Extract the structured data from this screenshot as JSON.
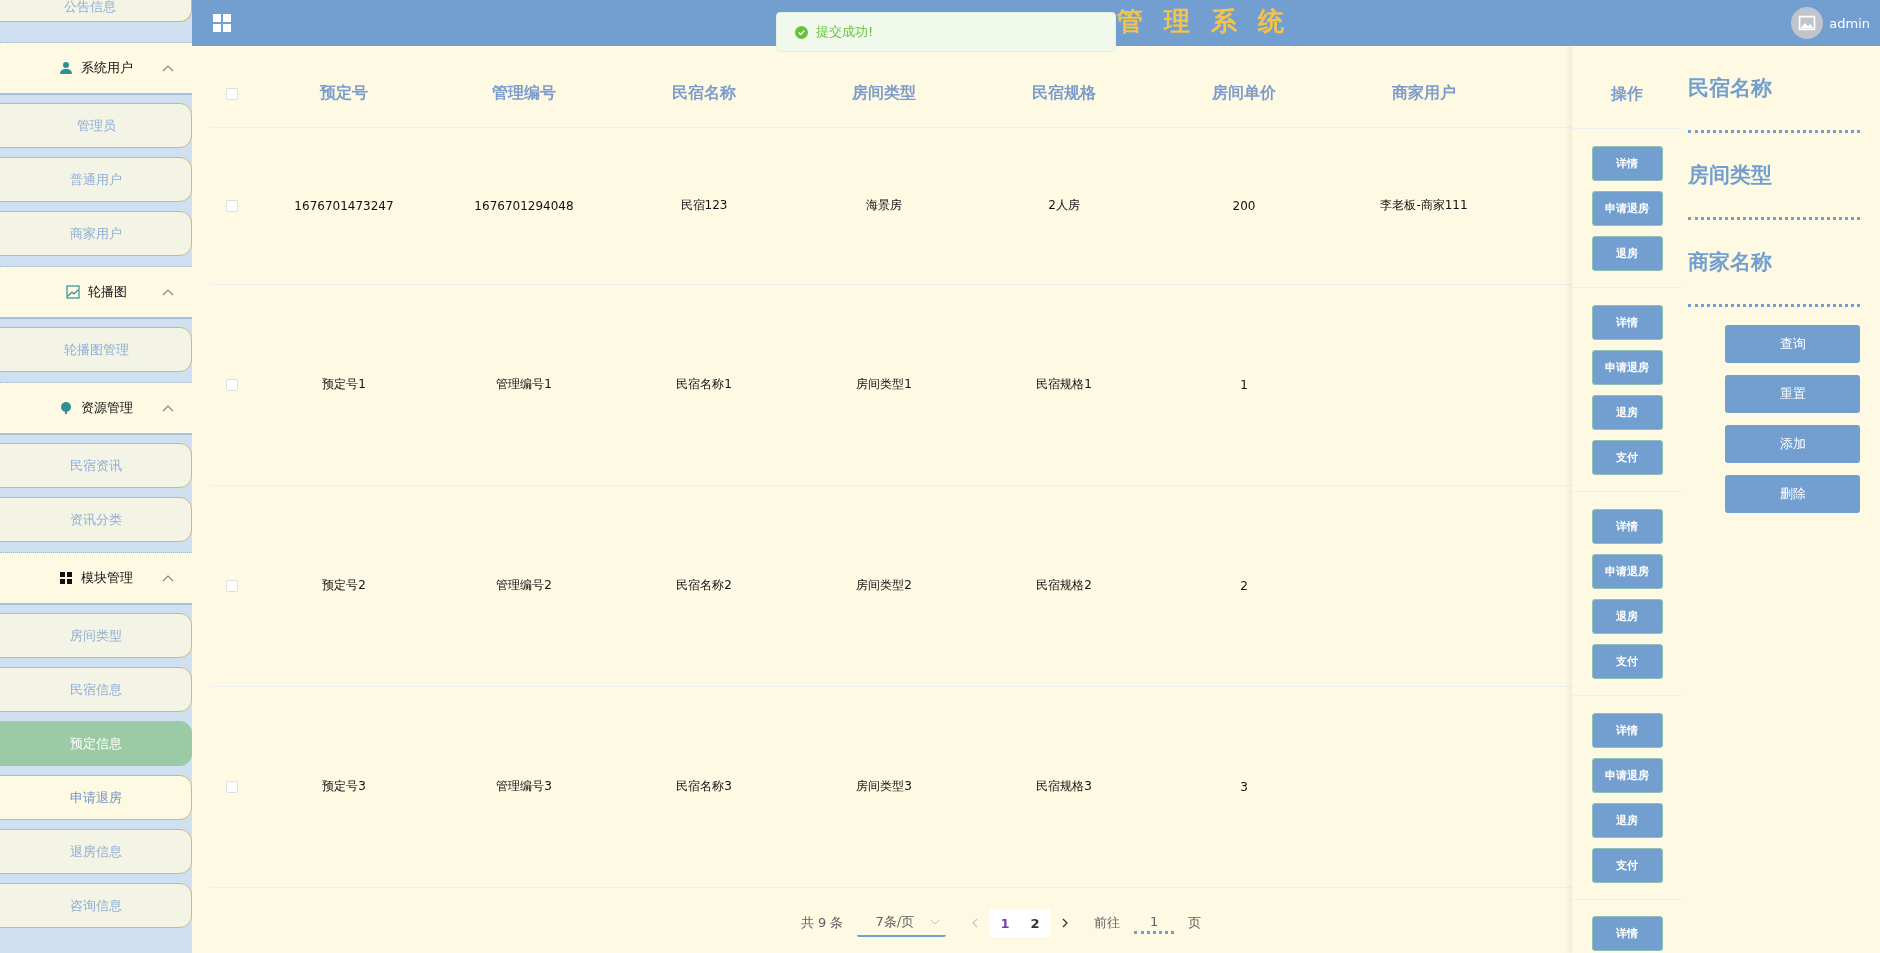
{
  "header": {
    "title": "管 理 系 统",
    "user": "admin"
  },
  "toast": {
    "message": "提交成功!"
  },
  "sidebar": {
    "top_item": "公告信息",
    "groups": [
      {
        "title": "系统用户",
        "kind": "user",
        "expanded": true,
        "items": [
          {
            "label": "管理员",
            "selected": false,
            "hovered": false
          },
          {
            "label": "普通用户",
            "selected": false,
            "hovered": false
          },
          {
            "label": "商家用户",
            "selected": false,
            "hovered": false
          }
        ]
      },
      {
        "title": "轮播图",
        "kind": "image",
        "expanded": true,
        "items": [
          {
            "label": "轮播图管理",
            "selected": false,
            "hovered": false
          }
        ]
      },
      {
        "title": "资源管理",
        "kind": "pin",
        "expanded": true,
        "items": [
          {
            "label": "民宿资讯",
            "selected": false,
            "hovered": false
          },
          {
            "label": "资讯分类",
            "selected": false,
            "hovered": false
          }
        ]
      },
      {
        "title": "模块管理",
        "kind": "grid",
        "expanded": true,
        "items": [
          {
            "label": "房间类型",
            "selected": false,
            "hovered": false
          },
          {
            "label": "民宿信息",
            "selected": false,
            "hovered": false
          },
          {
            "label": "预定信息",
            "selected": true,
            "hovered": false
          },
          {
            "label": "申请退房",
            "selected": false,
            "hovered": true
          },
          {
            "label": "退房信息",
            "selected": false,
            "hovered": false
          },
          {
            "label": "咨询信息",
            "selected": false,
            "hovered": false
          }
        ]
      }
    ]
  },
  "table": {
    "all_checked": false,
    "columns": [
      "预定号",
      "管理编号",
      "民宿名称",
      "房间类型",
      "民宿规格",
      "房间单价",
      "商家用户"
    ],
    "actions_column": "操作",
    "rows": [
      {
        "checked": false,
        "cells": [
          "1676701473247",
          "1676701294048",
          "民宿123",
          "海景房",
          "2人房",
          "200",
          "李老板-商家111"
        ],
        "actions": [
          "详情",
          "申请退房",
          "退房"
        ]
      },
      {
        "checked": false,
        "cells": [
          "预定号1",
          "管理编号1",
          "民宿名称1",
          "房间类型1",
          "民宿规格1",
          "1",
          ""
        ],
        "actions": [
          "详情",
          "申请退房",
          "退房",
          "支付"
        ]
      },
      {
        "checked": false,
        "cells": [
          "预定号2",
          "管理编号2",
          "民宿名称2",
          "房间类型2",
          "民宿规格2",
          "2",
          ""
        ],
        "actions": [
          "详情",
          "申请退房",
          "退房",
          "支付"
        ]
      },
      {
        "checked": false,
        "cells": [
          "预定号3",
          "管理编号3",
          "民宿名称3",
          "房间类型3",
          "民宿规格3",
          "3",
          ""
        ],
        "actions": [
          "详情",
          "申请退房",
          "退房",
          "支付"
        ]
      }
    ],
    "partial_row_actions": [
      "详情"
    ]
  },
  "pagination": {
    "total": "共 9 条",
    "page_size": "7条/页",
    "pages": [
      {
        "label": "1",
        "selected": true
      },
      {
        "label": "2",
        "selected": false
      }
    ],
    "prev_disabled": true,
    "goto_label": "前往",
    "goto_value": "1",
    "goto_suffix": "页"
  },
  "search": {
    "fields": [
      {
        "placeholder": "民宿名称"
      },
      {
        "placeholder": "房间类型"
      },
      {
        "placeholder": "商家名称"
      }
    ],
    "buttons": [
      "查询",
      "重置",
      "添加",
      "删除"
    ]
  }
}
